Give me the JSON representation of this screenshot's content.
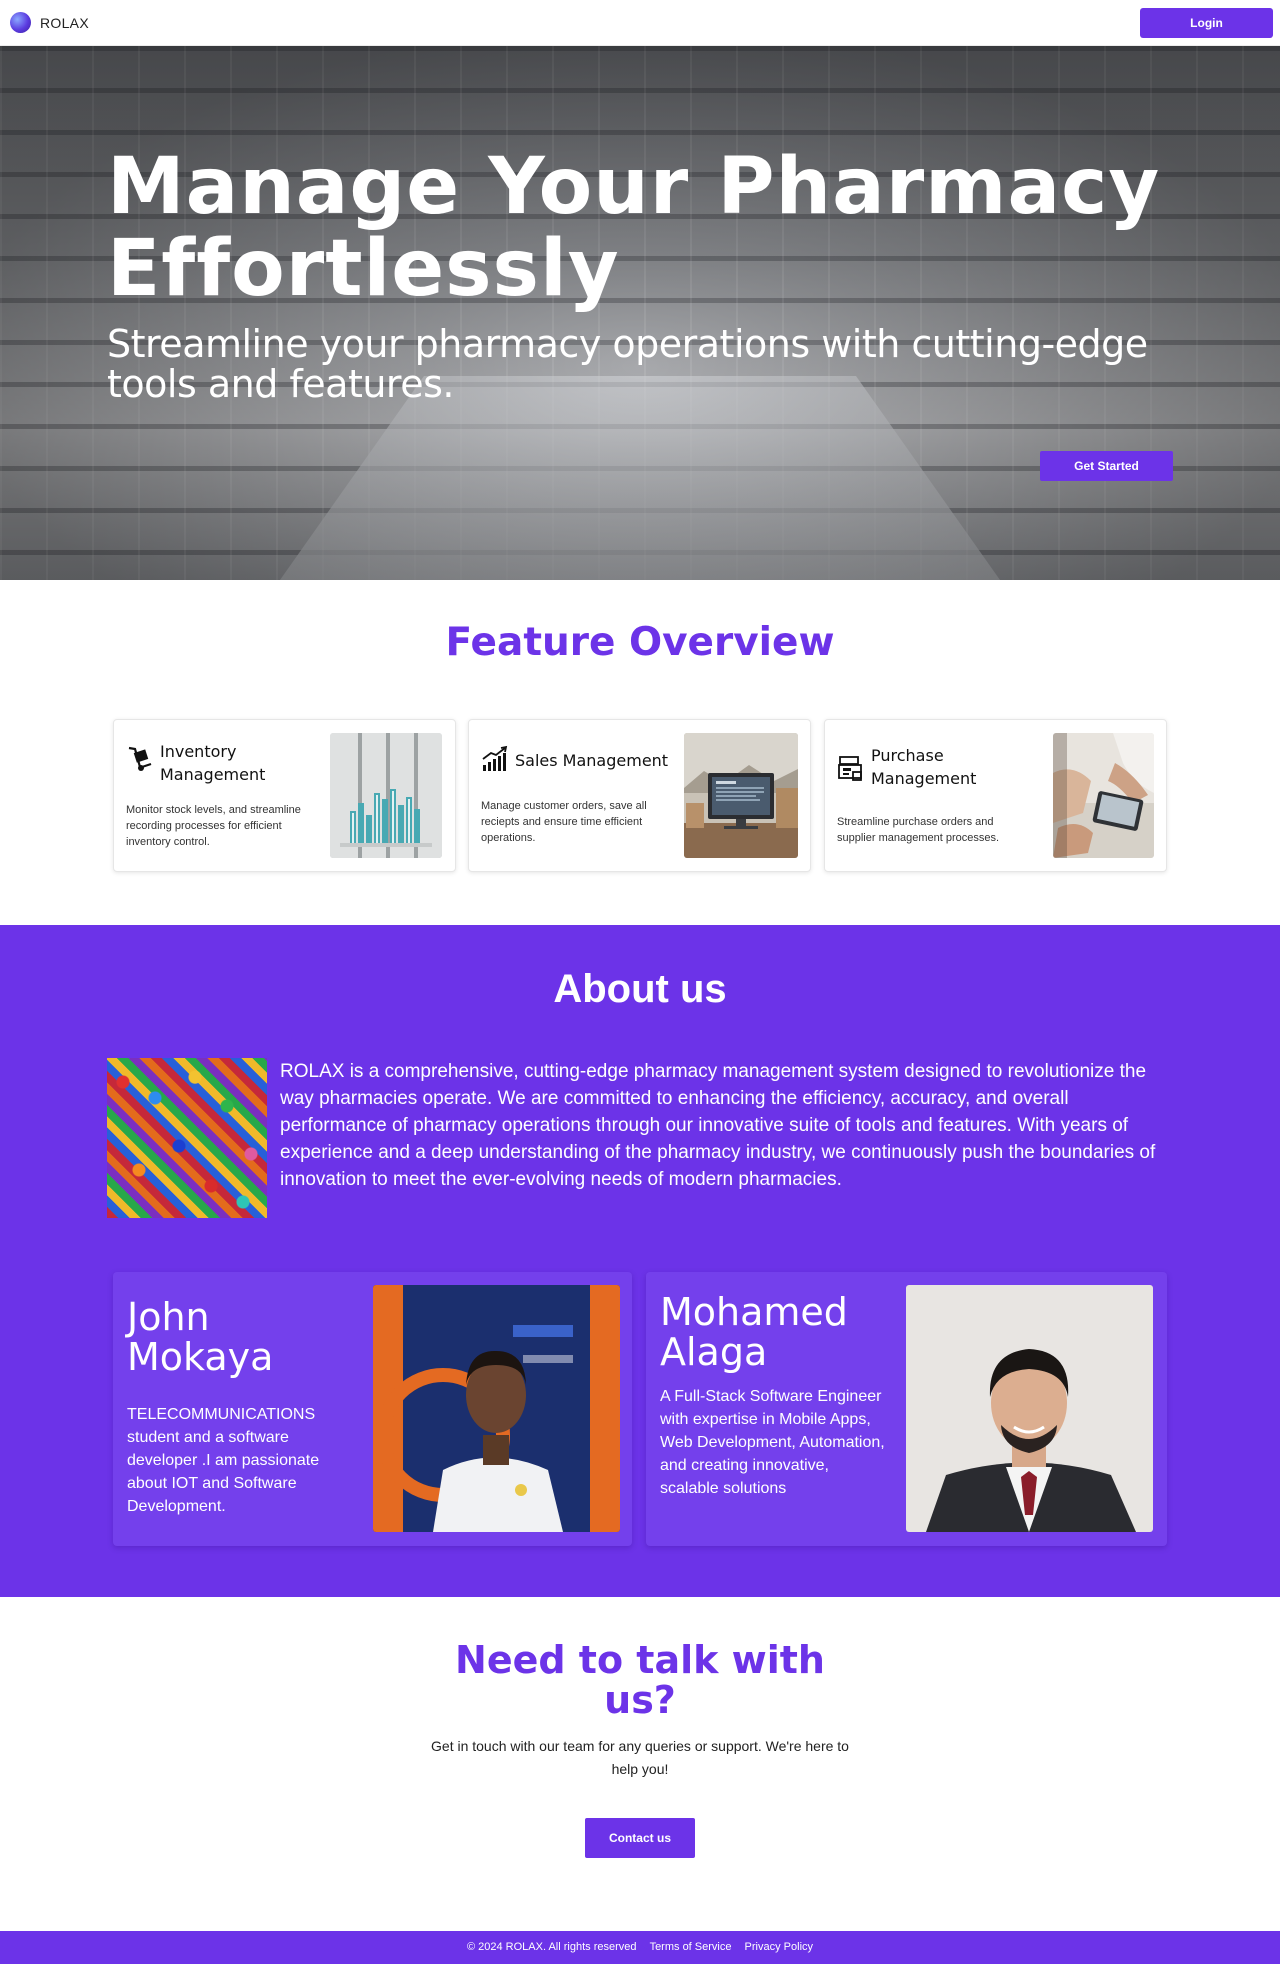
{
  "navbar": {
    "brand": "ROLAX",
    "login_label": "Login"
  },
  "hero": {
    "title": "Manage Your Pharmacy Effortlessly",
    "subtitle": "Streamline your pharmacy operations with cutting-edge tools and features.",
    "cta_label": "Get Started"
  },
  "features": {
    "title": "Feature Overview",
    "cards": [
      {
        "title": "Inventory Management",
        "description": "Monitor stock levels, and streamline recording processes for efficient inventory control.",
        "icon": "hand-truck-icon"
      },
      {
        "title": "Sales Management",
        "description": "Manage customer orders, save all reciepts and ensure time efficient operations.",
        "icon": "sales-chart-icon"
      },
      {
        "title": "Purchase Management",
        "description": "Streamline purchase orders and supplier management processes.",
        "icon": "cash-register-icon"
      }
    ]
  },
  "about": {
    "title": "About us",
    "text": "ROLAX is a comprehensive, cutting-edge pharmacy management system designed to revolutionize the way pharmacies operate. We are committed to enhancing the efficiency, accuracy, and overall performance of pharmacy operations through our innovative suite of tools and features. With years of experience and a deep understanding of the pharmacy industry, we continuously push the boundaries of innovation to meet the ever-evolving needs of modern pharmacies.",
    "team": [
      {
        "name": "John Mokaya",
        "bio": "TELECOMMUNICATIONS student and a software developer .I am passionate about IOT and Software Development."
      },
      {
        "name": "Mohamed Alaga",
        "bio": "A Full-Stack Software Engineer with expertise in Mobile Apps, Web Development, Automation, and creating innovative, scalable solutions"
      }
    ]
  },
  "contact": {
    "title_line1": "Need to talk with",
    "title_line2": "us?",
    "text": "Get in touch with our team for any queries or support. We're here to help you!",
    "button_label": "Contact us"
  },
  "footer": {
    "copyright": "© 2024 ROLAX. All rights reserved",
    "terms": "Terms of Service",
    "privacy": "Privacy Policy"
  },
  "colors": {
    "accent": "#6c33e8",
    "white": "#ffffff"
  }
}
